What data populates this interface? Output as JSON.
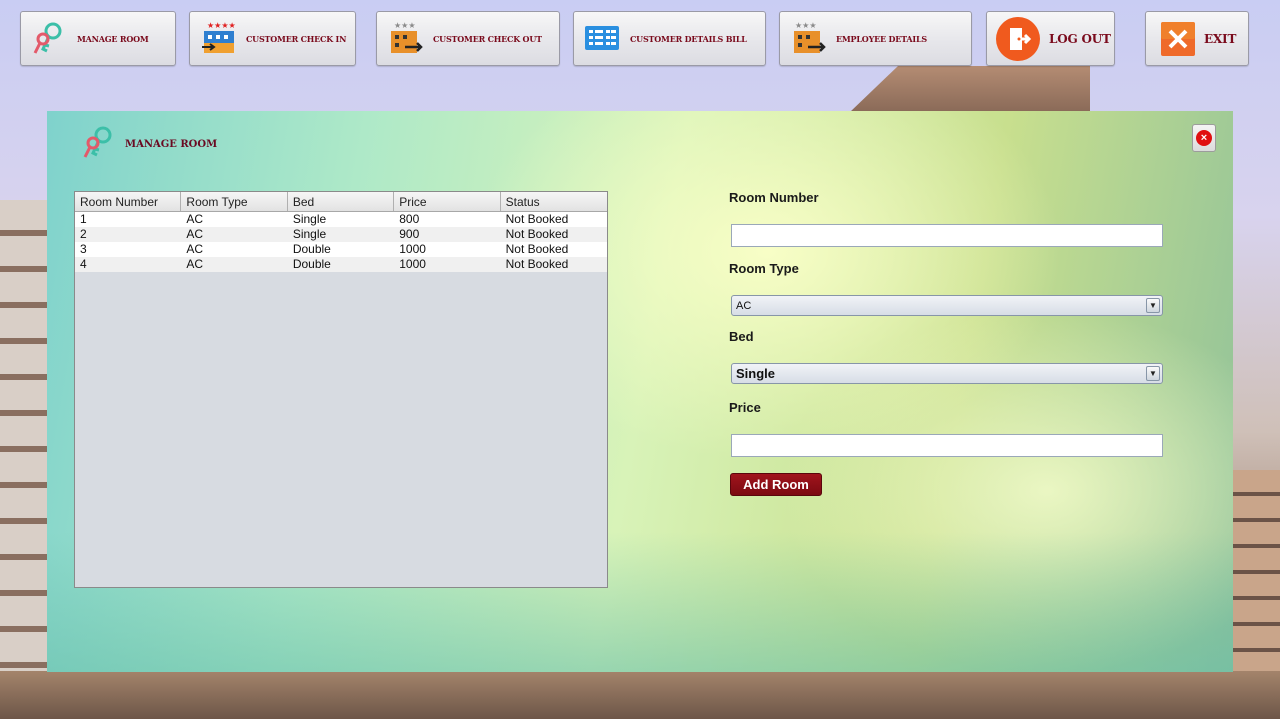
{
  "toolbar": {
    "buttons": [
      {
        "label": "MANAGE ROOM",
        "icon": "key-icon"
      },
      {
        "label": "CUSTOMER CHECK IN",
        "icon": "hotel-checkin-icon"
      },
      {
        "label": "CUSTOMER CHECK OUT",
        "icon": "hotel-checkout-icon"
      },
      {
        "label": "CUSTOMER DETAILS BILL",
        "icon": "list-icon"
      },
      {
        "label": "EMPLOYEE DETAILS",
        "icon": "hotel-employee-icon"
      },
      {
        "label": "LOG OUT",
        "icon": "logout-icon"
      },
      {
        "label": "EXIT",
        "icon": "exit-icon"
      }
    ]
  },
  "panel": {
    "title": "MANAGE ROOM",
    "close_icon": "close-icon"
  },
  "table": {
    "columns": [
      "Room Number",
      "Room Type",
      "Bed",
      "Price",
      "Status"
    ],
    "rows": [
      [
        "1",
        "AC",
        "Single",
        "800",
        "Not Booked"
      ],
      [
        "2",
        "AC",
        "Single",
        "900",
        "Not Booked"
      ],
      [
        "3",
        "AC",
        "Double",
        "1000",
        "Not Booked"
      ],
      [
        "4",
        "AC",
        "Double",
        "1000",
        "Not Booked"
      ]
    ]
  },
  "form": {
    "room_number_label": "Room Number",
    "room_number_value": "",
    "room_type_label": "Room Type",
    "room_type_value": "AC",
    "bed_label": "Bed",
    "bed_value": "Single",
    "price_label": "Price",
    "price_value": "",
    "add_button": "Add Room"
  },
  "colors": {
    "accent": "#7a0a1c",
    "add_button": "#8c0e16",
    "close": "#e01010"
  }
}
